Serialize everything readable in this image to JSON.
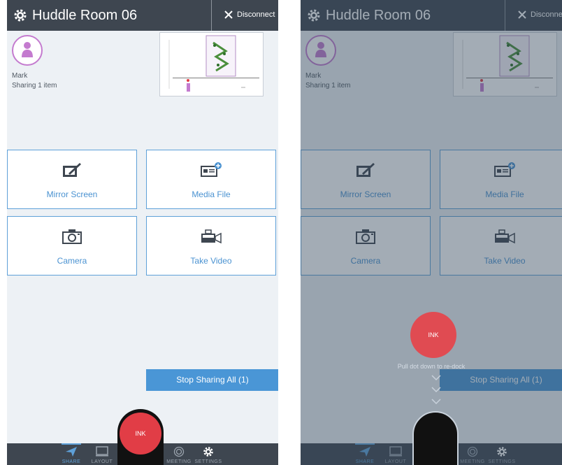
{
  "room": {
    "title": "Huddle Room 06",
    "disconnect_label": "Disconnect"
  },
  "user": {
    "name": "Mark",
    "status": "Sharing 1 item"
  },
  "tiles": [
    {
      "label": "Mirror Screen",
      "icon": "mirror-screen-icon"
    },
    {
      "label": "Media File",
      "icon": "media-file-icon"
    },
    {
      "label": "Camera",
      "icon": "camera-icon"
    },
    {
      "label": "Take Video",
      "icon": "video-camera-icon"
    }
  ],
  "stop_sharing_label": "Stop Sharing All (1)",
  "ink_label": "INK",
  "redock_hint": "Pull dot down to re-dock",
  "nav": [
    {
      "label": "SHARE",
      "icon": "paper-plane-icon",
      "active": true
    },
    {
      "label": "LAYOUT",
      "icon": "monitor-icon",
      "active": false
    },
    {
      "label": "MEETING",
      "icon": "target-icon",
      "active": false
    },
    {
      "label": "SETTINGS",
      "icon": "gear-icon",
      "active": false
    }
  ],
  "colors": {
    "header": "#3e4650",
    "accent": "#4a92d1",
    "ink": "#e13d46",
    "avatar": "#c47bcf",
    "background": "#edf1f5"
  }
}
